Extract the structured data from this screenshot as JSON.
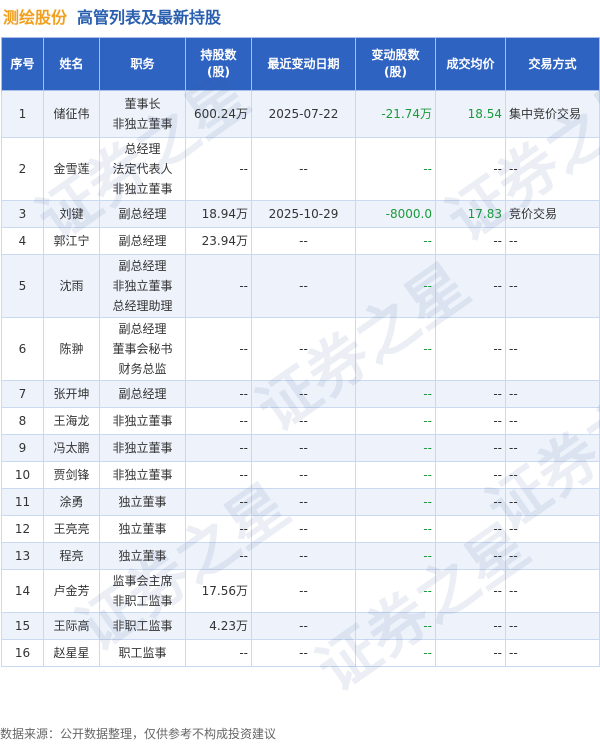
{
  "header": {
    "company": "测绘股份",
    "subtitle": "高管列表及最新持股"
  },
  "table": {
    "columns": [
      "序号",
      "姓名",
      "职务",
      "持股数\n(股)",
      "最近变动日期",
      "变动股数\n(股)",
      "成交均价",
      "交易方式"
    ],
    "rows": [
      {
        "no": "1",
        "name": "储征伟",
        "position": [
          "董事长",
          "非独立董事"
        ],
        "shares": "600.24万",
        "date": "2025-07-22",
        "change": "-21.74万",
        "price": "18.54",
        "method": "集中竞价交易"
      },
      {
        "no": "2",
        "name": "金雪莲",
        "position": [
          "总经理",
          "法定代表人",
          "非独立董事"
        ],
        "shares": "--",
        "date": "--",
        "change": "--",
        "price": "--",
        "method": "--"
      },
      {
        "no": "3",
        "name": "刘键",
        "position": [
          "副总经理"
        ],
        "shares": "18.94万",
        "date": "2025-10-29",
        "change": "-8000.0",
        "price": "17.83",
        "method": "竞价交易"
      },
      {
        "no": "4",
        "name": "郭江宁",
        "position": [
          "副总经理"
        ],
        "shares": "23.94万",
        "date": "--",
        "change": "--",
        "price": "--",
        "method": "--"
      },
      {
        "no": "5",
        "name": "沈雨",
        "position": [
          "副总经理",
          "非独立董事",
          "总经理助理"
        ],
        "shares": "--",
        "date": "--",
        "change": "--",
        "price": "--",
        "method": "--"
      },
      {
        "no": "6",
        "name": "陈翀",
        "position": [
          "副总经理",
          "董事会秘书",
          "财务总监"
        ],
        "shares": "--",
        "date": "--",
        "change": "--",
        "price": "--",
        "method": "--"
      },
      {
        "no": "7",
        "name": "张开坤",
        "position": [
          "副总经理"
        ],
        "shares": "--",
        "date": "--",
        "change": "--",
        "price": "--",
        "method": "--"
      },
      {
        "no": "8",
        "name": "王海龙",
        "position": [
          "非独立董事"
        ],
        "shares": "--",
        "date": "--",
        "change": "--",
        "price": "--",
        "method": "--"
      },
      {
        "no": "9",
        "name": "冯太鹏",
        "position": [
          "非独立董事"
        ],
        "shares": "--",
        "date": "--",
        "change": "--",
        "price": "--",
        "method": "--"
      },
      {
        "no": "10",
        "name": "贾剑锋",
        "position": [
          "非独立董事"
        ],
        "shares": "--",
        "date": "--",
        "change": "--",
        "price": "--",
        "method": "--"
      },
      {
        "no": "11",
        "name": "涂勇",
        "position": [
          "独立董事"
        ],
        "shares": "--",
        "date": "--",
        "change": "--",
        "price": "--",
        "method": "--"
      },
      {
        "no": "12",
        "name": "王亮亮",
        "position": [
          "独立董事"
        ],
        "shares": "--",
        "date": "--",
        "change": "--",
        "price": "--",
        "method": "--"
      },
      {
        "no": "13",
        "name": "程亮",
        "position": [
          "独立董事"
        ],
        "shares": "--",
        "date": "--",
        "change": "--",
        "price": "--",
        "method": "--"
      },
      {
        "no": "14",
        "name": "卢金芳",
        "position": [
          "监事会主席",
          "非职工监事"
        ],
        "shares": "17.56万",
        "date": "--",
        "change": "--",
        "price": "--",
        "method": "--"
      },
      {
        "no": "15",
        "name": "王际高",
        "position": [
          "非职工监事"
        ],
        "shares": "4.23万",
        "date": "--",
        "change": "--",
        "price": "--",
        "method": "--"
      },
      {
        "no": "16",
        "name": "赵星星",
        "position": [
          "职工监事"
        ],
        "shares": "--",
        "date": "--",
        "change": "--",
        "price": "--",
        "method": "--"
      }
    ]
  },
  "footer": {
    "source": "数据来源：公开数据整理，仅供参考不构成投资建议"
  },
  "watermark": {
    "text": "证券之星"
  },
  "colors": {
    "company": "#f0a020",
    "subtitle": "#2a5fb0",
    "header_bg": "#2f63c2",
    "negative_change": "#1a9a3a"
  }
}
